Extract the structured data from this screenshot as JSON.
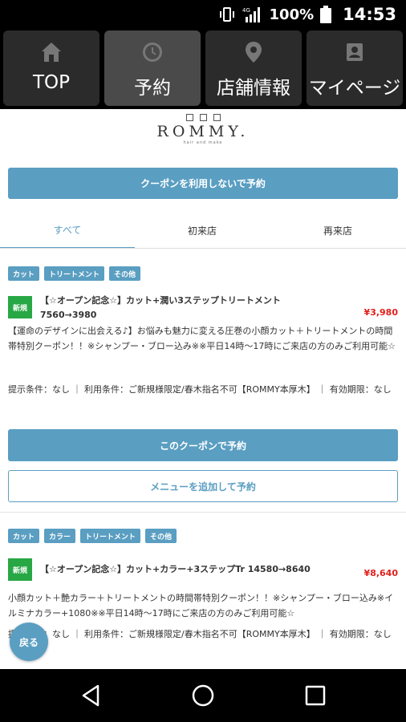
{
  "status_bar": {
    "battery": "100%",
    "time": "14:53",
    "network": "4G"
  },
  "nav": {
    "tabs": [
      {
        "label": "TOP",
        "icon": "home-icon",
        "active": false
      },
      {
        "label": "予約",
        "icon": "clock-icon",
        "active": true
      },
      {
        "label": "店舗情報",
        "icon": "location-pin-icon",
        "active": false
      },
      {
        "label": "マイページ",
        "icon": "profile-card-icon",
        "active": false
      }
    ]
  },
  "logo": {
    "name": "ROMMY.",
    "sub": "hair and make"
  },
  "reserve_without_coupon": "クーポンを利用しないで予約",
  "filters": {
    "all": "すべて",
    "first_visit": "初来店",
    "return_visit": "再来店"
  },
  "coupons": [
    {
      "tags": [
        "カット",
        "トリートメント",
        "その他"
      ],
      "badge": "新規",
      "title": "【☆オープン記念☆】カット+潤い3ステップトリートメント 7560→3980",
      "price": "¥3,980",
      "description": "【運命のデザインに出会える♪】お悩みも魅力に変える圧巻の小顔カット＋トリートメントの時間帯特別クーポン！！※シャンプー・ブロー込み※※平日14時〜17時にご来店の方のみご利用可能☆",
      "conditions": "提示条件：なし ｜ 利用条件：ご新規様限定/春木指名不可【ROMMY本厚木】 ｜ 有効期限：なし",
      "reserve_label": "このクーポンで予約",
      "add_menu_label": "メニューを追加して予約"
    },
    {
      "tags": [
        "カット",
        "カラー",
        "トリートメント",
        "その他"
      ],
      "badge": "新規",
      "title": "【☆オープン記念☆】カット+カラー+3ステップTr 14580→8640",
      "price": "¥8,640",
      "description": "小顔カット＋艶カラー＋トリートメントの時間帯特別クーポン！！※シャンプー・ブロー込み※イルミナカラー+1080※※平日14時〜17時にご来店の方のみご利用可能☆",
      "conditions": "提示条件：なし ｜ 利用条件：ご新規様限定/春木指名不可【ROMMY本厚木】 ｜ 有効期限：なし"
    }
  ],
  "back_button": "戻る",
  "colors": {
    "accent": "#5a9ec2",
    "price": "#e0201b",
    "badge": "#28a745"
  }
}
